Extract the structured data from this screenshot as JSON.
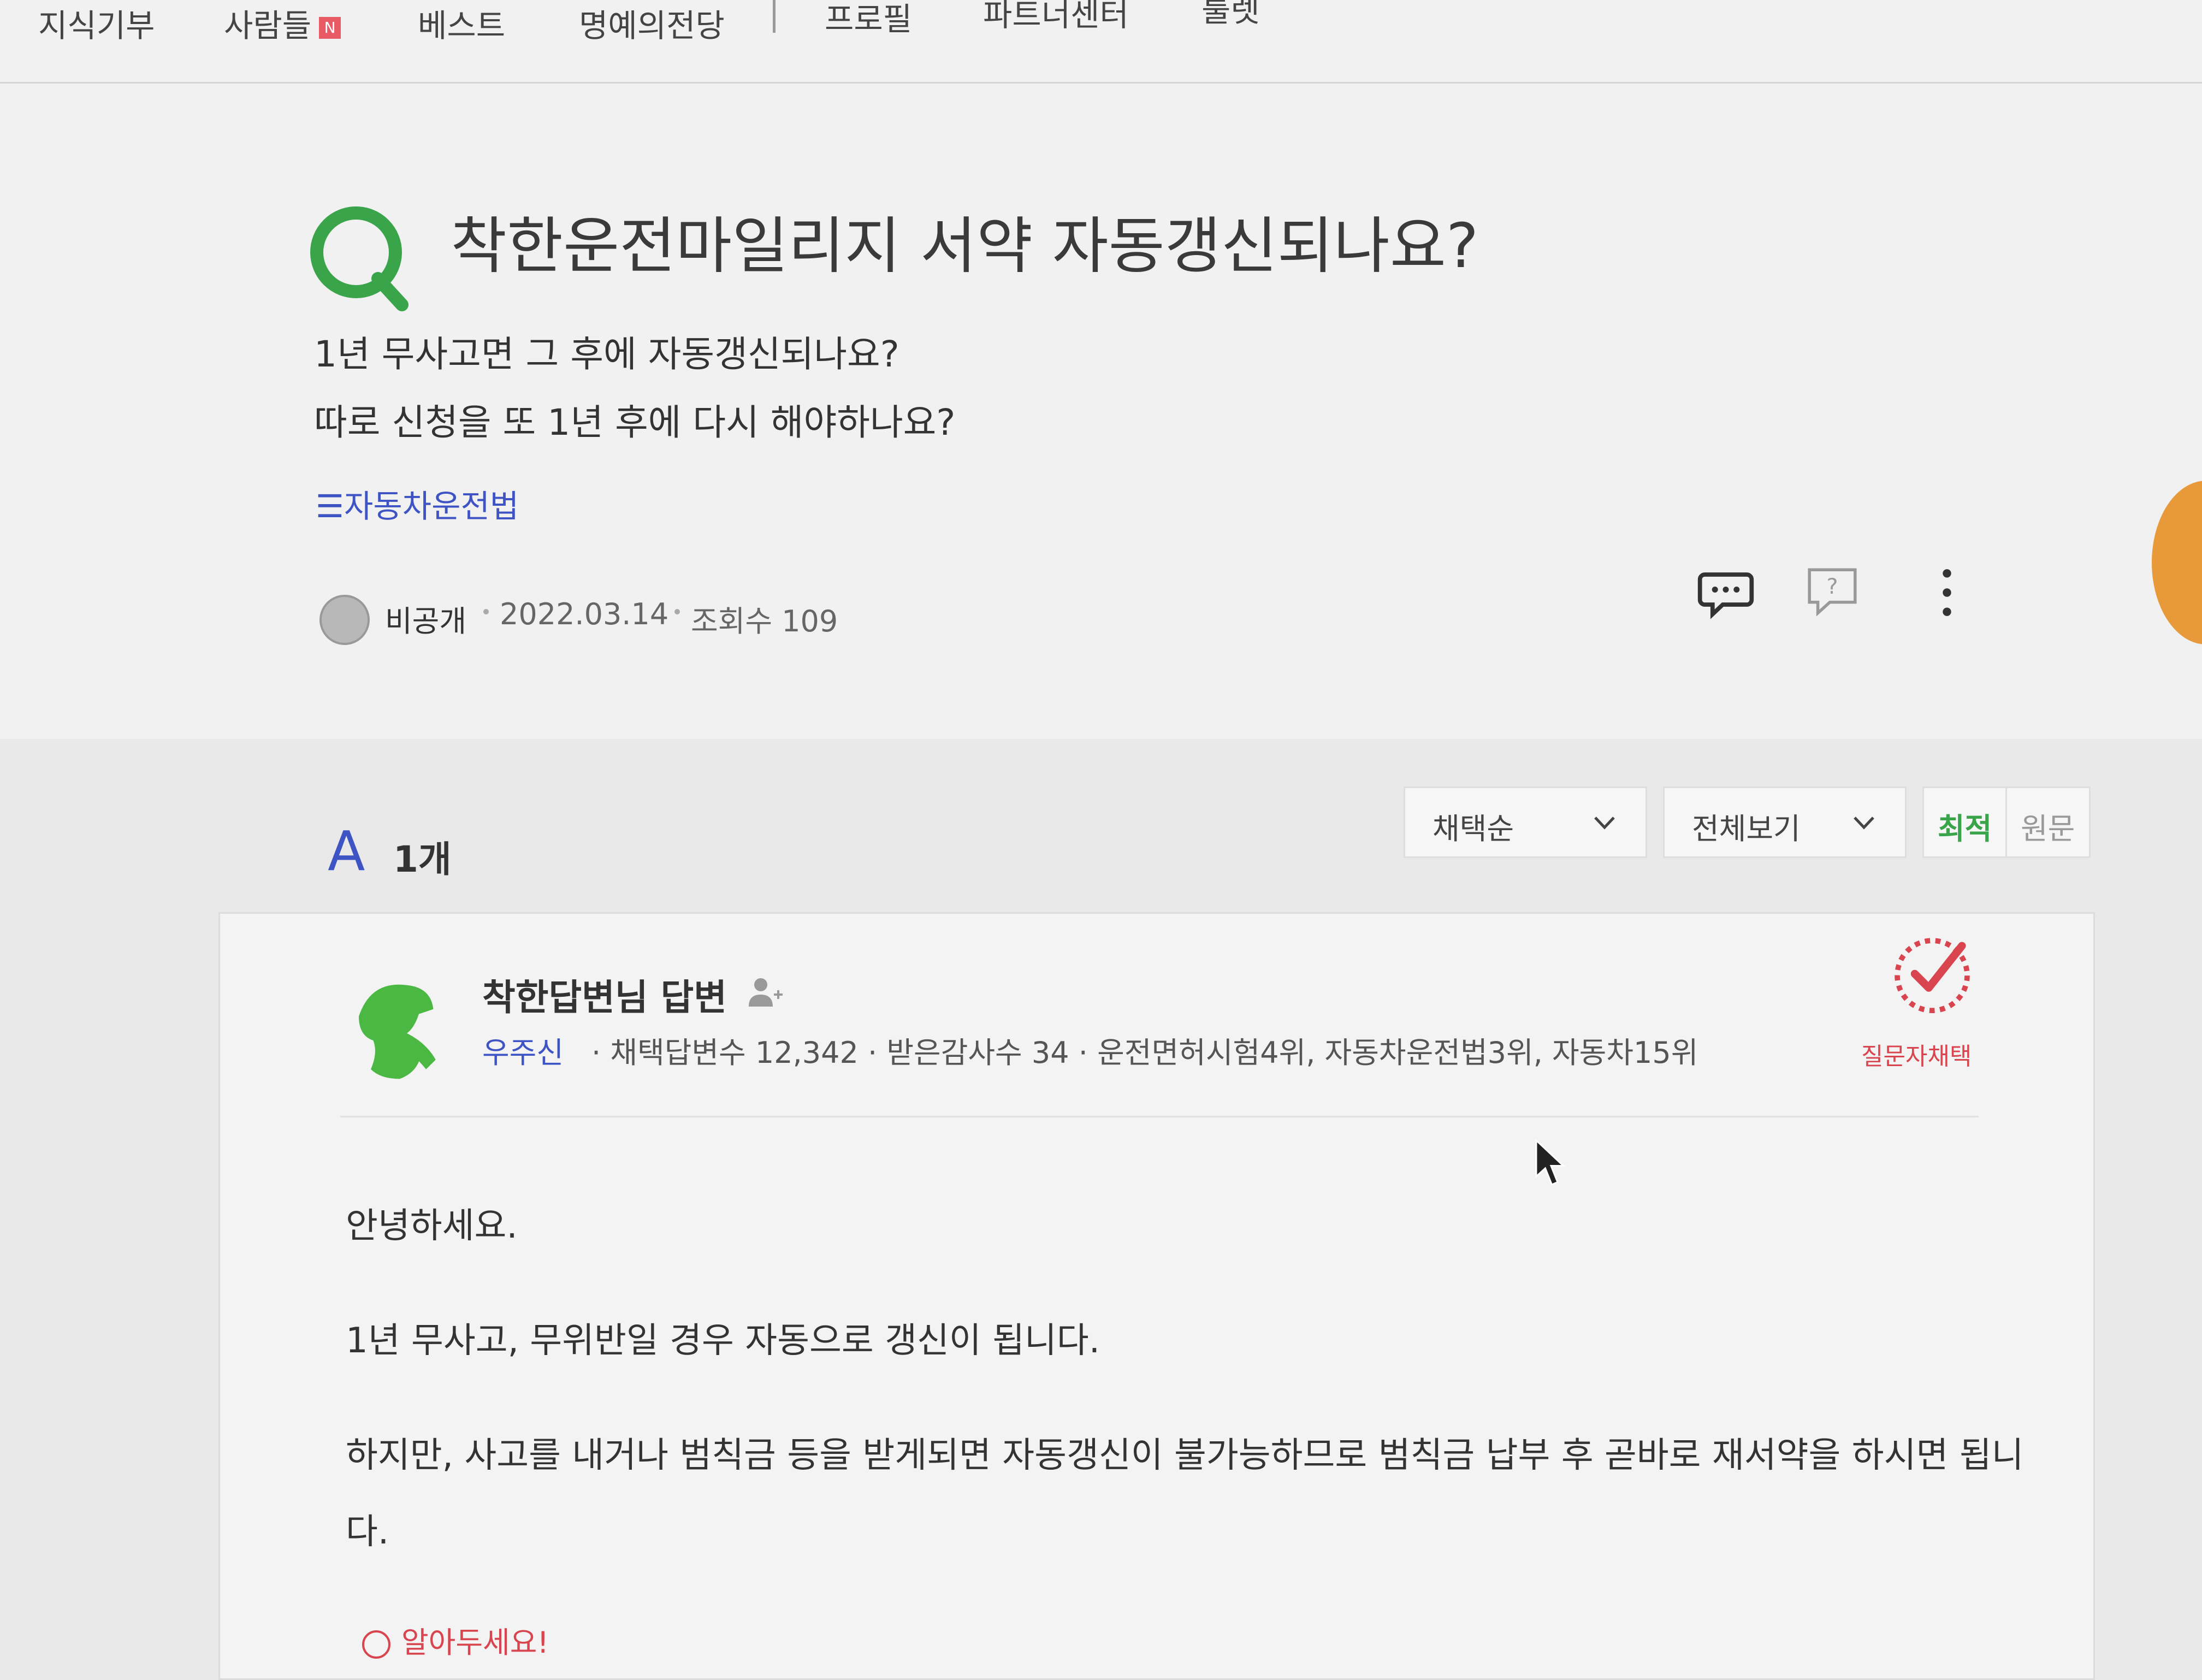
{
  "nav": {
    "items": [
      "지식기부",
      "사람들",
      "베스트",
      "명예의전당",
      "프로필",
      "파트너센터",
      "툴렛"
    ],
    "new_badge": "N"
  },
  "question": {
    "title": "착한운전마일리지 서약 자동갱신되나요?",
    "body_line1": "1년 무사고면 그 후에 자동갱신되나요?",
    "body_line2": "따로 신청을 또 1년 후에 다시 해야하나요?",
    "tag": "자동차운전법",
    "author": "비공개",
    "date": "2022.03.14",
    "views": "조회수 109",
    "accent_color": "#3aa44a"
  },
  "answers": {
    "letter": "A",
    "count": "1개",
    "sort_select": "채택순",
    "view_select": "전체보기",
    "latest_btn": "최적",
    "original_btn": "원문"
  },
  "answer": {
    "author": "착한답변님 답변",
    "grade": "우주신",
    "stats": "· 채택답변수 12,342 · 받은감사수 34 · 운전면허시험4위, 자동차운전법3위, 자동차15위",
    "accepted_label": "질문자채택",
    "greeting": "안녕하세요.",
    "line1": "1년 무사고, 무위반일 경우 자동으로 갱신이 됩니다.",
    "line2": "하지만, 사고를 내거나 범칙금 등을 받게되면 자동갱신이 불가능하므로 범칙금 납부 후 곧바로 재서약을 하시면 됩니",
    "line2b": "다.",
    "notice": "알아두세요!"
  }
}
